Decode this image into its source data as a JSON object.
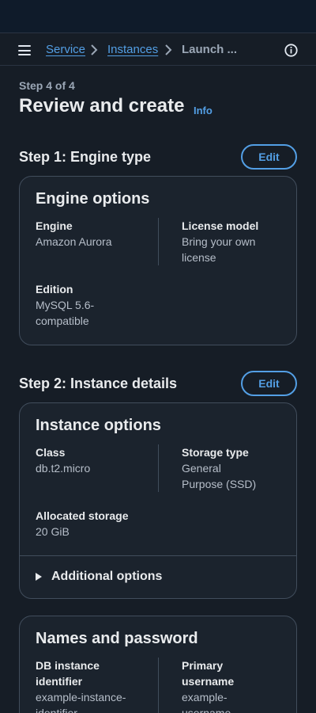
{
  "breadcrumbs": {
    "items": [
      "Service",
      "Instances"
    ],
    "current": "Launch ..."
  },
  "header": {
    "step_of": "Step 4 of 4",
    "title": "Review and create",
    "info_link": "Info"
  },
  "sections": [
    {
      "title": "Step 1: Engine type",
      "edit_label": "Edit",
      "card": {
        "title": "Engine options",
        "fields": [
          {
            "label": "Engine",
            "value": "Amazon Aurora"
          },
          {
            "label": "License model",
            "value": "Bring your own license"
          },
          {
            "label": "Edition",
            "value": "MySQL 5.6-compatible"
          }
        ]
      }
    },
    {
      "title": "Step 2: Instance details",
      "edit_label": "Edit",
      "card": {
        "title": "Instance options",
        "fields": [
          {
            "label": "Class",
            "value": "db.t2.micro"
          },
          {
            "label": "Storage type",
            "value": "General Purpose (SSD)"
          },
          {
            "label": "Allocated storage",
            "value": "20 GiB"
          }
        ],
        "expander": "Additional options"
      }
    }
  ],
  "names_card": {
    "title": "Names and password",
    "fields": [
      {
        "label": "DB instance identifier",
        "value": "example-instance-identifier"
      },
      {
        "label": "Primary username",
        "value": "example-username"
      }
    ]
  },
  "colors": {
    "link": "#539fe5",
    "background": "#161d26",
    "card": "#1b232d",
    "border": "#414d5c"
  }
}
